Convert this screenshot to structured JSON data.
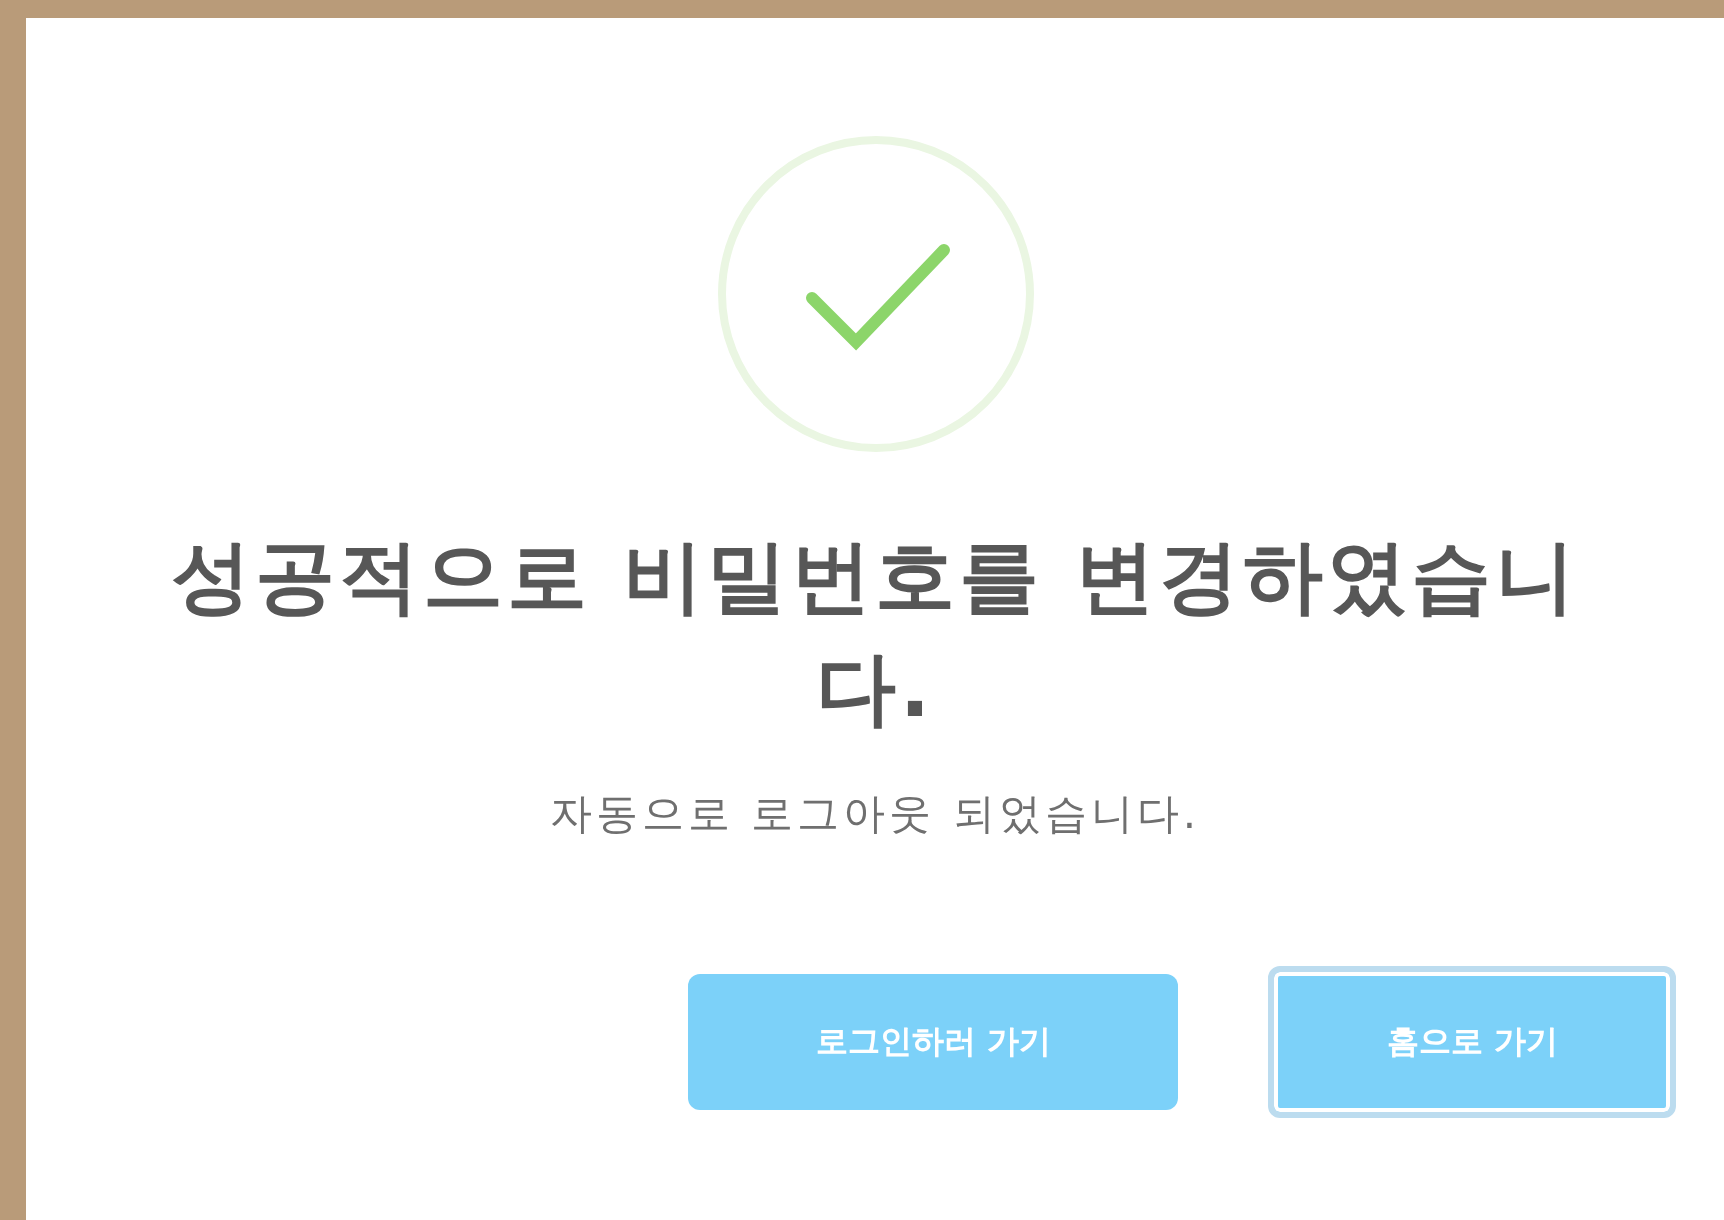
{
  "dialog": {
    "title": "성공적으로 비밀번호를 변경하였습니다.",
    "text": "자동으로 로그아웃 되었습니다.",
    "buttons": [
      {
        "label": "로그인하러 가기",
        "focused": false
      },
      {
        "label": "홈으로 가기",
        "focused": true
      }
    ]
  }
}
